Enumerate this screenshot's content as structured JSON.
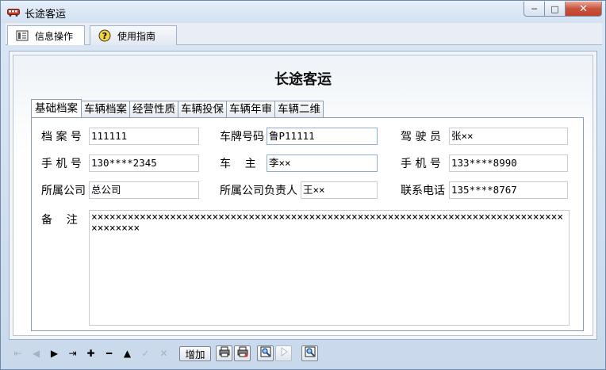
{
  "window": {
    "title": "长途客运",
    "minimize": "─",
    "maximize": "□",
    "close": "✕"
  },
  "menu": {
    "tabs": [
      {
        "label": "信息操作",
        "icon": "list-icon"
      },
      {
        "label": "使用指南",
        "icon": "help-icon"
      }
    ]
  },
  "main": {
    "heading": "长途客运",
    "tabs": [
      "基础档案",
      "车辆档案",
      "经营性质",
      "车辆投保",
      "车辆年审",
      "车辆二维"
    ]
  },
  "form": {
    "file_no_label": "档 案 号",
    "file_no": "111111",
    "plate_label": "车牌号码",
    "plate": "鲁P11111",
    "driver_label": "驾 驶 员",
    "driver": "张××",
    "phone_label": "手 机 号",
    "phone": "130****2345",
    "owner_label": "车    主",
    "owner": "李××",
    "owner_phone_label": "手 机 号",
    "owner_phone": "133****8990",
    "company_label": "所属公司",
    "company": "总公司",
    "manager_label": "所属公司负责人",
    "manager": "王××",
    "contact_label": "联系电话",
    "contact": "135****8767",
    "notes_label": "备    注",
    "notes": "××××××××××××××××××××××××××××××××××××××××××××××××××××××××××××××××××××××××××××××××××××××"
  },
  "toolbar": {
    "first": "⇤",
    "prev": "◀",
    "next": "▶",
    "last": "⇥",
    "plus": "✚",
    "minus": "━",
    "up": "▲",
    "check": "✓",
    "cancel": "✕",
    "add_label": "增加"
  }
}
